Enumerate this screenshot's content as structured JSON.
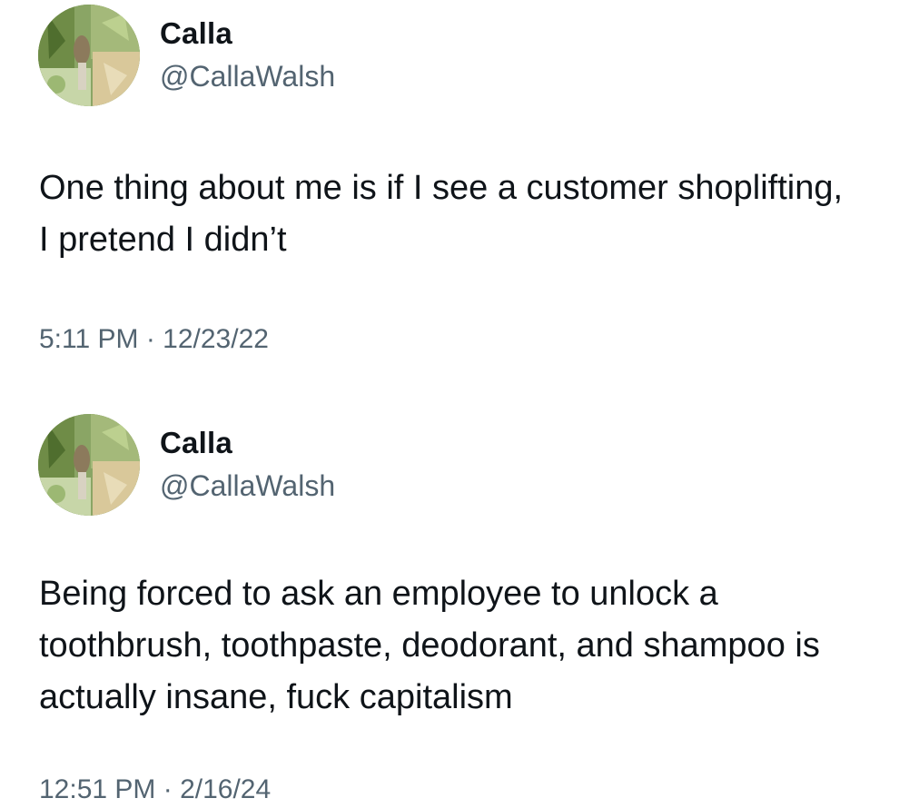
{
  "tweets": [
    {
      "author": {
        "display_name": "Calla",
        "handle": "@CallaWalsh",
        "avatar_icon": "profile-photo"
      },
      "text": "One thing about me is if I see a customer shoplifting, I pretend I didn’t",
      "timestamp": "5:11 PM · 12/23/22"
    },
    {
      "author": {
        "display_name": "Calla",
        "handle": "@CallaWalsh",
        "avatar_icon": "profile-photo"
      },
      "text": "Being forced to ask an employee to unlock a toothbrush, toothpaste, deodorant, and shampoo is actually insane, fuck capitalism",
      "timestamp": "12:51 PM · 2/16/24"
    }
  ],
  "colors": {
    "text_primary": "#0f1419",
    "text_secondary": "#536471",
    "background": "#ffffff"
  }
}
